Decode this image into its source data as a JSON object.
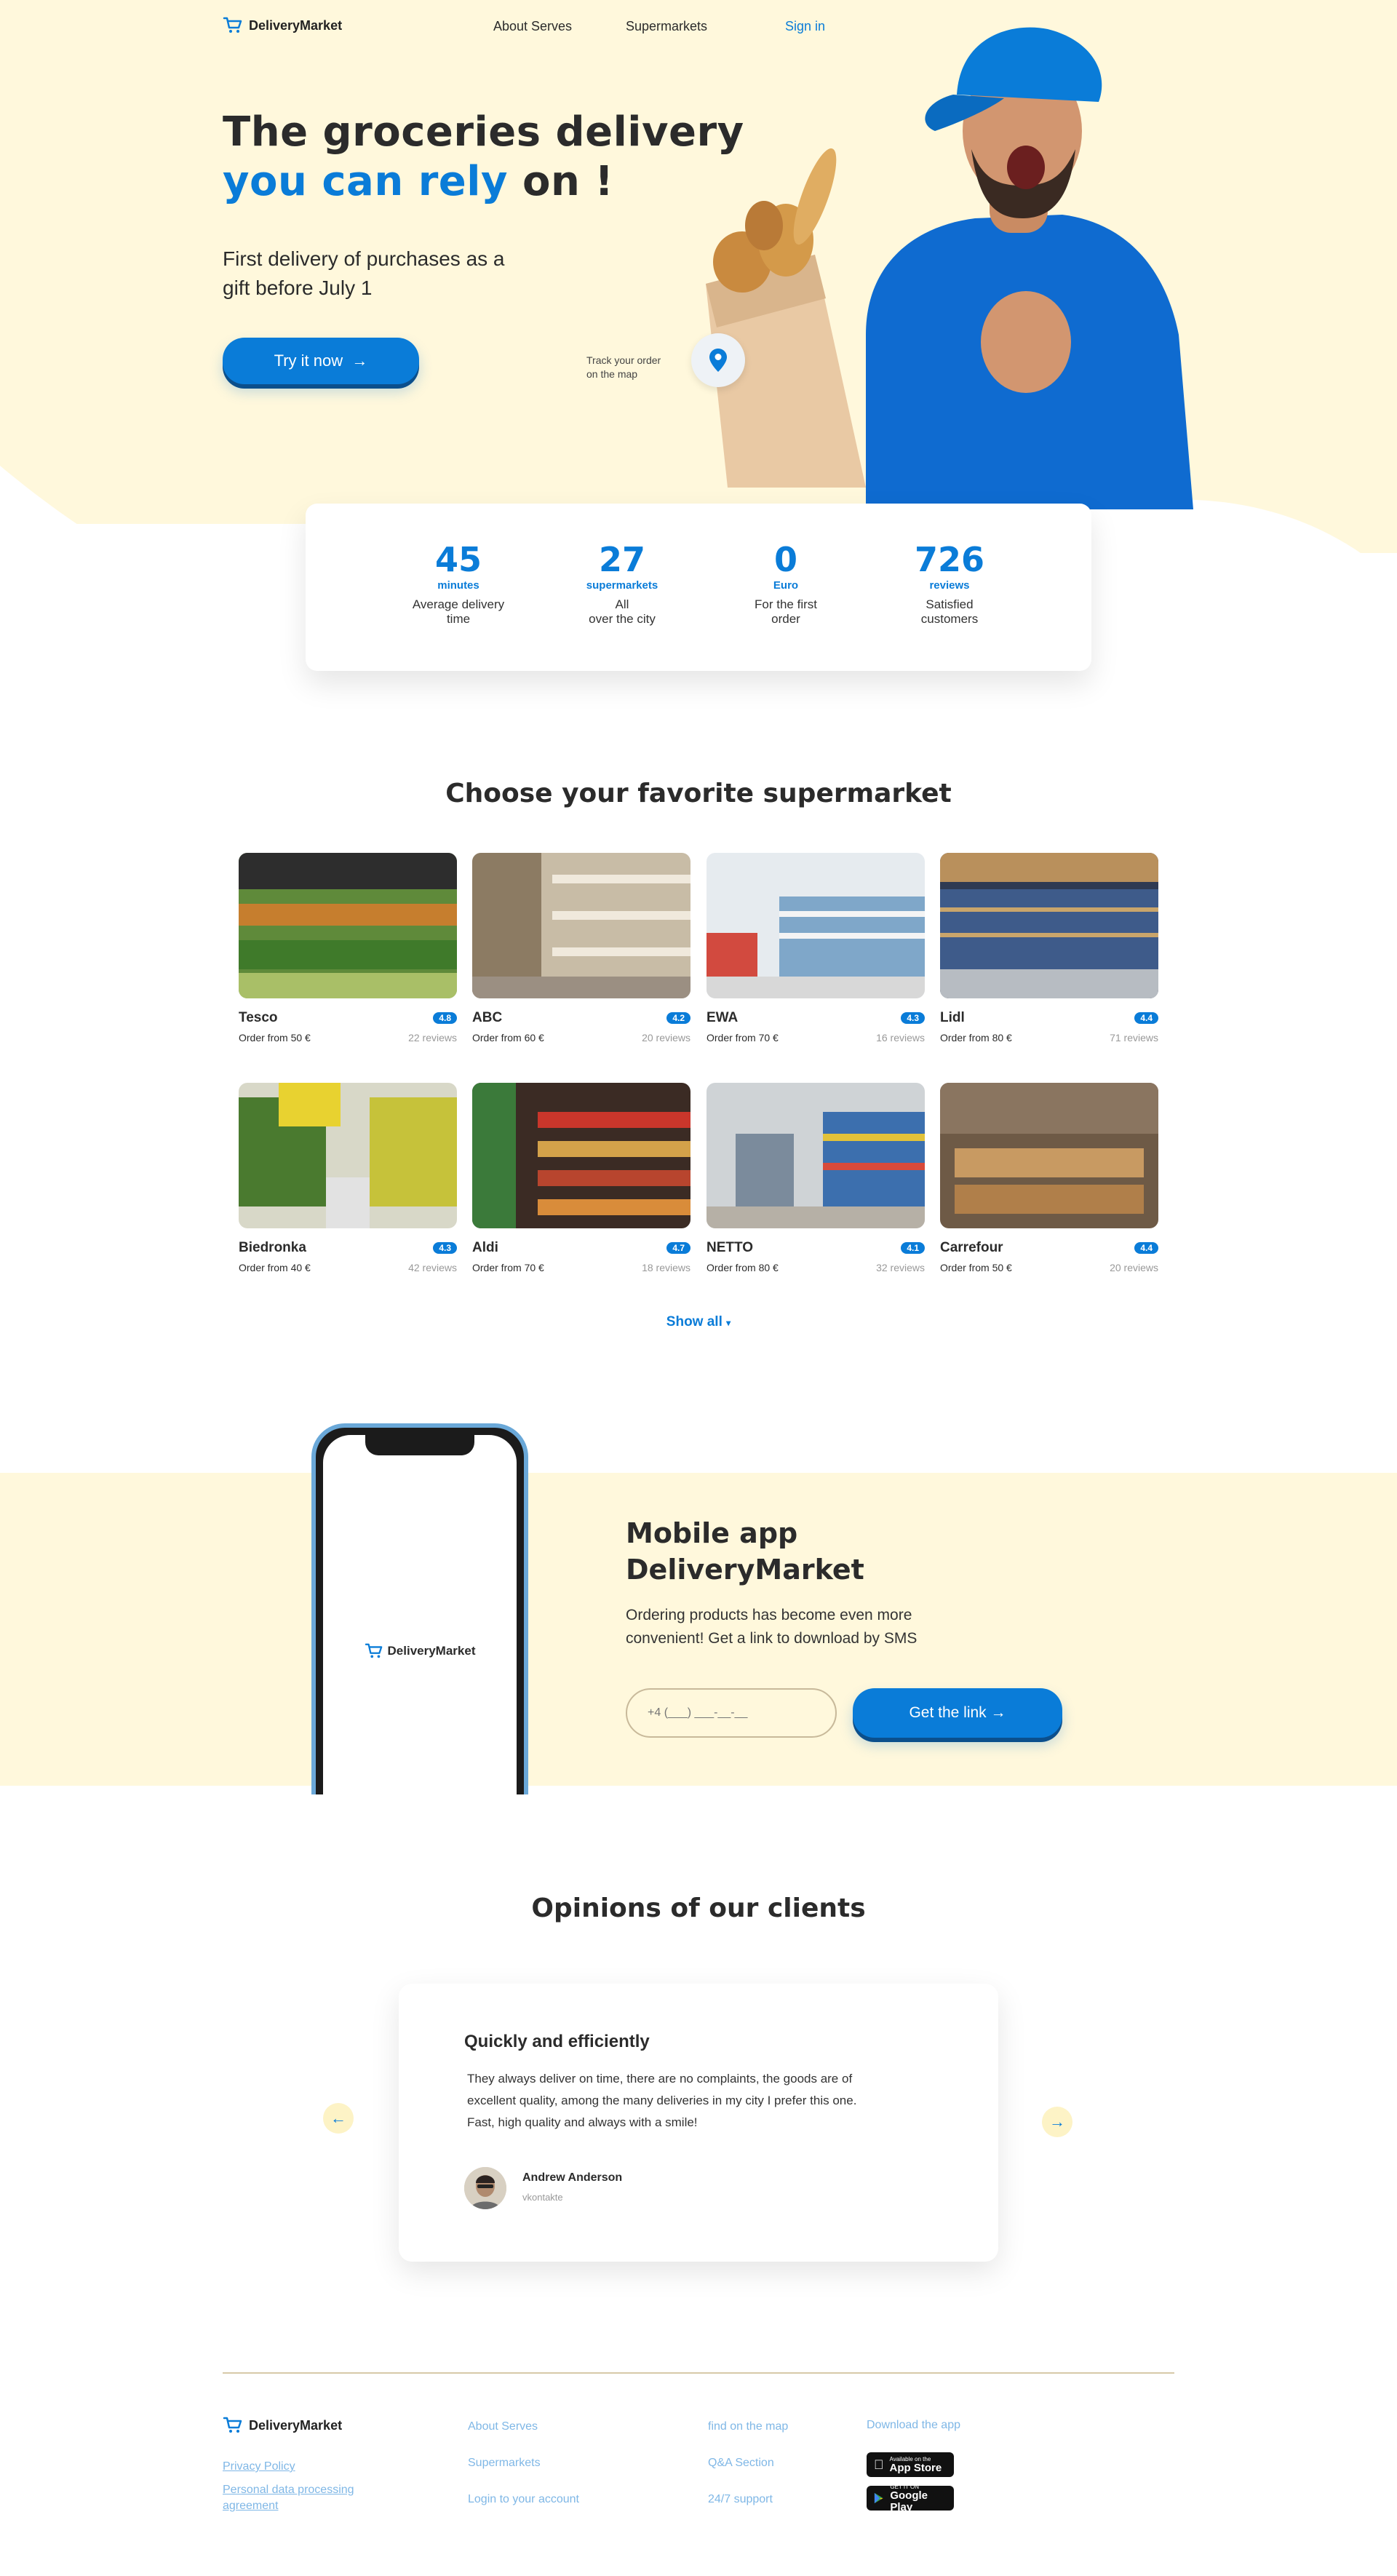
{
  "header": {
    "brand": "DeliveryMarket",
    "nav": [
      "About Serves",
      "Supermarkets"
    ],
    "signin": "Sign in"
  },
  "hero": {
    "title_line1": "The groceries delivery",
    "title_accent": "you can rely",
    "title_end": "on !",
    "subtitle_line1": "First delivery of purchases as a",
    "subtitle_line2": "gift before July 1",
    "cta": "Try it now",
    "track_line1": "Track your order",
    "track_line2": "on the map"
  },
  "stats": [
    {
      "num": "45",
      "unit": "minutes",
      "desc1": "Average delivery",
      "desc2": "time"
    },
    {
      "num": "27",
      "unit": "supermarkets",
      "desc1": "All",
      "desc2": "over the city"
    },
    {
      "num": "0",
      "unit": "Euro",
      "desc1": "For the first",
      "desc2": "order"
    },
    {
      "num": "726",
      "unit": "reviews",
      "desc1": "Satisfied",
      "desc2": "customers"
    }
  ],
  "supermarkets": {
    "title": "Choose your favorite supermarket",
    "items": [
      {
        "name": "Tesco",
        "rating": "4.8",
        "order": "Order from 50 €",
        "reviews": "22 reviews",
        "color": "#5f8a3a"
      },
      {
        "name": "ABC",
        "rating": "4.2",
        "order": "Order from 60 €",
        "reviews": "20 reviews",
        "color": "#b9a98e"
      },
      {
        "name": "EWA",
        "rating": "4.3",
        "order": "Order from 70 €",
        "reviews": "16 reviews",
        "color": "#c9d3dc"
      },
      {
        "name": "Lidl",
        "rating": "4.4",
        "order": "Order from 80 €",
        "reviews": "71 reviews",
        "color": "#3d4a63"
      },
      {
        "name": "Biedronka",
        "rating": "4.3",
        "order": "Order from 40 €",
        "reviews": "42 reviews",
        "color": "#9fb44a"
      },
      {
        "name": "Aldi",
        "rating": "4.7",
        "order": "Order from 70 €",
        "reviews": "18 reviews",
        "color": "#a0542f"
      },
      {
        "name": "NETTO",
        "rating": "4.1",
        "order": "Order from 80 €",
        "reviews": "32 reviews",
        "color": "#6f7e8f"
      },
      {
        "name": "Carrefour",
        "rating": "4.4",
        "order": "Order from 50 €",
        "reviews": "20 reviews",
        "color": "#a27e55"
      }
    ],
    "show_all": "Show all"
  },
  "app": {
    "title_line1": "Mobile app",
    "title_line2": "DeliveryMarket",
    "text_line1": "Ordering products has become even more",
    "text_line2": "convenient! Get a link to download by SMS",
    "phone_placeholder": "+4 (___) ___-__-__",
    "button": "Get the link",
    "phone_brand": "DeliveryMarket"
  },
  "opinions": {
    "title": "Opinions of our clients",
    "review_title": "Quickly and efficiently",
    "review_line1": "They always deliver on time, there are no complaints, the goods are of",
    "review_line2": "excellent quality, among the many deliveries in my city I prefer this one.",
    "review_line3": "Fast, high quality and always with a smile!",
    "author": "Andrew Anderson",
    "source": "vkontakte"
  },
  "footer": {
    "brand": "DeliveryMarket",
    "privacy": "Privacy Policy",
    "personal_line1": "Personal data processing",
    "personal_line2": "agreement",
    "col2": [
      "About Serves",
      "Supermarkets",
      "Login to your account"
    ],
    "col3": [
      "find on the map",
      "Q&A Section",
      "24/7 support"
    ],
    "download": "Download the app",
    "appstore_small": "Available on the",
    "appstore": "App Store",
    "gplay_small": "GET IT ON",
    "gplay": "Google Play"
  },
  "colors": {
    "accent": "#0a7cd8",
    "cream": "#fff8dc",
    "text": "#2b2b2b"
  }
}
